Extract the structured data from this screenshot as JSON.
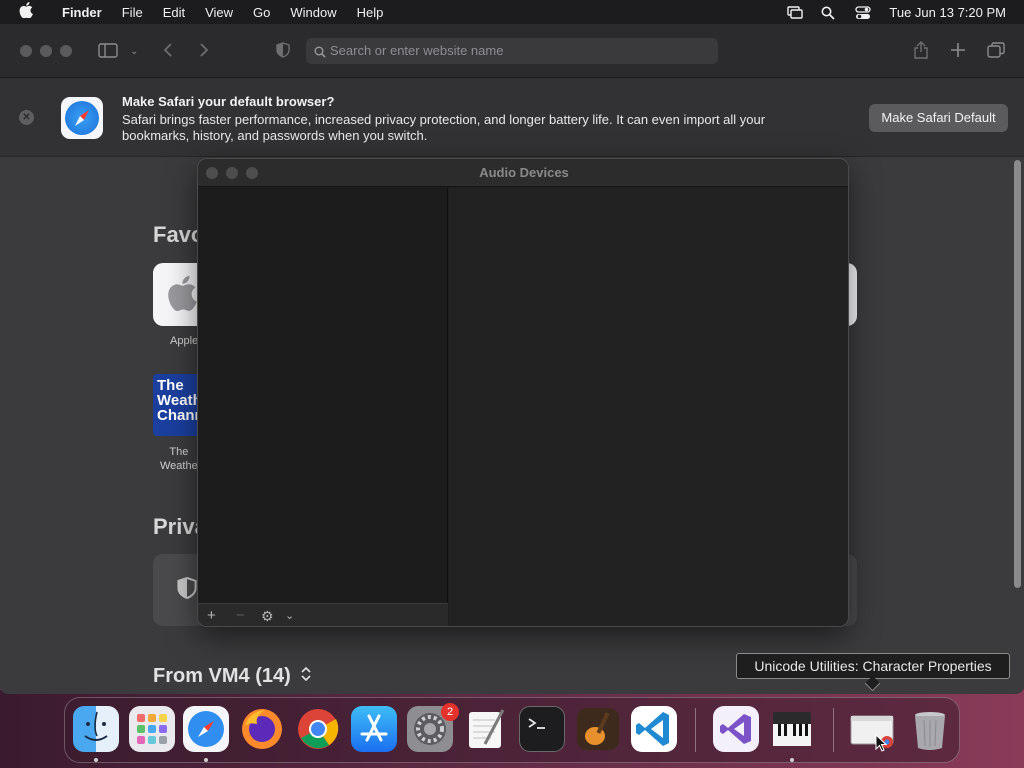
{
  "menubar": {
    "app_name": "Finder",
    "items": [
      "File",
      "Edit",
      "View",
      "Go",
      "Window",
      "Help"
    ],
    "clock": "Tue Jun 13  7:20 PM"
  },
  "safari": {
    "address_placeholder": "Search or enter website name",
    "banner": {
      "title": "Make Safari your default browser?",
      "body": "Safari brings faster performance, increased privacy protection, and longer battery life. It can even import all your bookmarks, history, and passwords when you switch.",
      "button": "Make Safari Default"
    },
    "favorites_heading": "Favo",
    "favorites": [
      {
        "label": "Apple",
        "icon": "apple-logo"
      },
      {
        "label": "The\nWeathe",
        "tile_text": "The\nWeath\nChann",
        "icon": "weather-channel-logo"
      }
    ],
    "privacy_heading": "Priva",
    "from_heading": "From VM4 (14)"
  },
  "audio_window": {
    "title": "Audio Devices",
    "bottom_controls": [
      "+",
      "−",
      "⚙",
      "⌄"
    ]
  },
  "tooltip": "Unicode Utilities: Character Properties",
  "dock": {
    "apps": [
      "Finder",
      "Launchpad",
      "Safari",
      "Firefox",
      "Chrome",
      "App Store",
      "System Settings",
      "TextEdit",
      "Terminal",
      "GarageBand",
      "Visual Studio Code",
      "Visual Studio",
      "Audio MIDI Setup",
      "Unicode Utilities",
      "Trash"
    ],
    "settings_badge": "2"
  }
}
